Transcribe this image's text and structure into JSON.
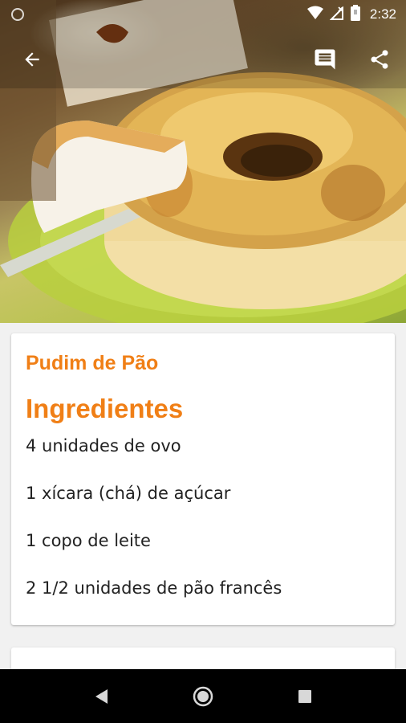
{
  "status_bar": {
    "time": "2:32",
    "icons": [
      "wifi-icon",
      "signal-off-icon",
      "battery-icon"
    ]
  },
  "toolbar": {
    "back_icon": "arrow-back-icon",
    "comment_icon": "comment-icon",
    "share_icon": "share-icon"
  },
  "recipe": {
    "title": "Pudim de Pão",
    "section_heading": "Ingredientes",
    "ingredients": [
      "4 unidades de ovo",
      "1 xícara (chá) de açúcar",
      "1 copo de leite",
      "2 1/2 unidades de pão francês"
    ]
  },
  "nav_bar": {
    "icons": [
      "nav-back-icon",
      "nav-home-icon",
      "nav-recent-icon"
    ]
  },
  "colors": {
    "accent": "#f07f16",
    "text": "#222222",
    "background": "#f1f1f1"
  }
}
